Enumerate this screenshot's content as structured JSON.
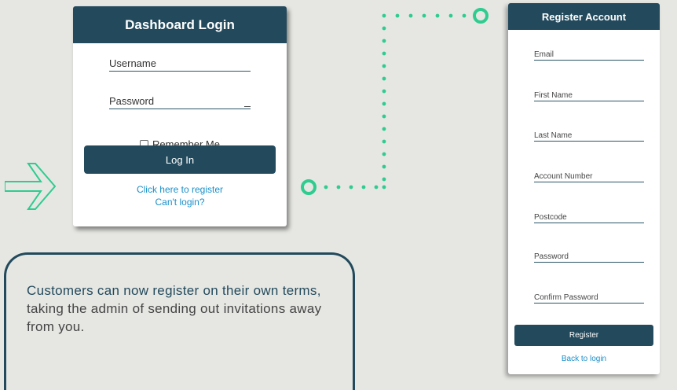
{
  "login": {
    "title": "Dashboard Login",
    "username_placeholder": "Username",
    "password_placeholder": "Password",
    "remember_label": "Remember Me",
    "login_button": "Log In",
    "register_link": "Click here to register",
    "cant_login_link": "Can't login?"
  },
  "info": {
    "highlight": "Customers can now register on their own terms,",
    "rest": " taking the admin of sending out invitations away from you."
  },
  "register": {
    "title": "Register Account",
    "fields": [
      "Email",
      "First Name",
      "Last Name",
      "Account Number",
      "Postcode",
      "Password",
      "Confirm Password"
    ],
    "submit_button": "Register",
    "back_link": "Back to login"
  },
  "colors": {
    "primary": "#234a5c",
    "accent_green": "#2ecc8f",
    "link": "#1a8fc9",
    "background": "#e6e7e3"
  },
  "icons": {
    "arrow": "right-arrow-icon"
  }
}
